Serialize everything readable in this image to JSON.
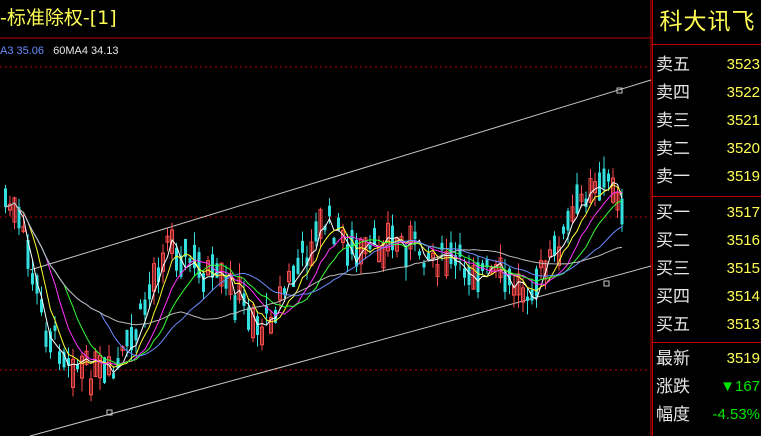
{
  "title": {
    "text": "-标准除权-[1]"
  },
  "ma_legend": [
    {
      "text": "A3 35.06",
      "color": "#6b8cff"
    },
    {
      "text": "60MA4 34.13",
      "color": "#e6e6e6"
    }
  ],
  "colors": {
    "up": "#ff4d4d",
    "down": "#33e0e0",
    "grid": "#c00000",
    "channel": "#c8c8c8",
    "ma1": "#ffffff",
    "ma2": "#ffff33",
    "ma3": "#ff33ff",
    "ma4": "#33ff33",
    "ma5": "#6b8cff",
    "ma6": "#bbbbbb"
  },
  "quote_panel": {
    "stock_name": "科大讯飞",
    "sell": [
      {
        "label": "卖五",
        "value": "3523"
      },
      {
        "label": "卖四",
        "value": "3522"
      },
      {
        "label": "卖三",
        "value": "3521"
      },
      {
        "label": "卖二",
        "value": "3520"
      },
      {
        "label": "卖一",
        "value": "3519"
      }
    ],
    "buy": [
      {
        "label": "买一",
        "value": "3517"
      },
      {
        "label": "买二",
        "value": "3516"
      },
      {
        "label": "买三",
        "value": "3515"
      },
      {
        "label": "买四",
        "value": "3514"
      },
      {
        "label": "买五",
        "value": "3513"
      }
    ],
    "stats": [
      {
        "label": "最新",
        "value": "3519",
        "color": "#ffff54"
      },
      {
        "label": "涨跌",
        "value": "▼167",
        "color": "#00e600"
      },
      {
        "label": "幅度",
        "value": "-4.53%",
        "color": "#00e600"
      }
    ]
  }
}
